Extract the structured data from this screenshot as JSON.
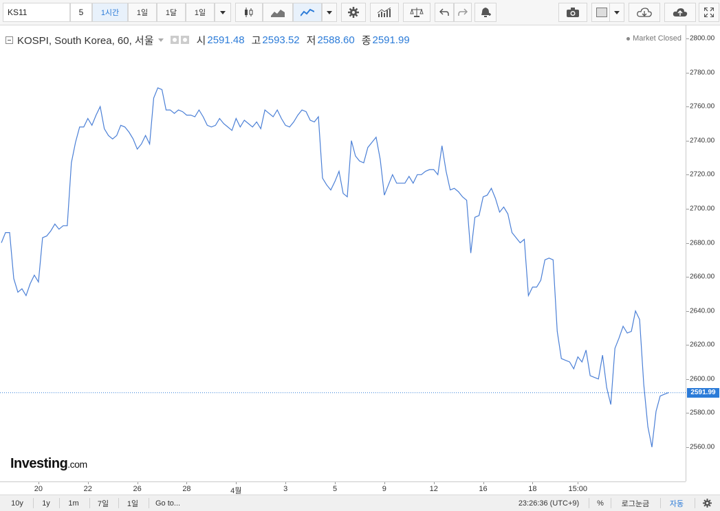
{
  "toolbar": {
    "symbol": "KS11",
    "interval_input": "5",
    "timeframes": [
      "1시간",
      "1일",
      "1달",
      "1일"
    ]
  },
  "legend": {
    "name": "KOSPI, South Korea, 60, 서울",
    "open_label": "시",
    "open": "2591.48",
    "high_label": "고",
    "high": "2593.52",
    "low_label": "저",
    "low": "2588.60",
    "close_label": "종",
    "close": "2591.99",
    "market_status": "Market Closed"
  },
  "branding": {
    "logo_main": "Investing",
    "logo_suffix": ".com"
  },
  "colors": {
    "line": "#4a7fd6",
    "accent": "#2b7bd8"
  },
  "bottom_bar": {
    "ranges": [
      "10y",
      "1y",
      "1m",
      "7일",
      "1일"
    ],
    "goto_label": "Go to...",
    "time": "23:26:36 (UTC+9)",
    "percent_label": "%",
    "log_label": "로그눈금",
    "auto_label": "자동"
  },
  "chart_data": {
    "type": "line",
    "title": "",
    "xlabel": "",
    "ylabel": "",
    "ylim": [
      2540,
      2805
    ],
    "yticks": [
      2800,
      2780,
      2760,
      2740,
      2720,
      2700,
      2680,
      2660,
      2640,
      2620,
      2600,
      2580,
      2560
    ],
    "ytick_labels": [
      "2800.00",
      "2780.00",
      "2760.00",
      "2740.00",
      "2720.00",
      "2700.00",
      "2680.00",
      "2660.00",
      "2640.00",
      "2620.00",
      "2600.00",
      "2580.00",
      "2560.00"
    ],
    "xticks": [
      {
        "label": "20",
        "i": 9
      },
      {
        "label": "22",
        "i": 21
      },
      {
        "label": "26",
        "i": 33
      },
      {
        "label": "28",
        "i": 45
      },
      {
        "label": "4월",
        "i": 57
      },
      {
        "label": "3",
        "i": 69
      },
      {
        "label": "5",
        "i": 81
      },
      {
        "label": "9",
        "i": 93
      },
      {
        "label": "12",
        "i": 105
      },
      {
        "label": "16",
        "i": 117
      },
      {
        "label": "18",
        "i": 129
      },
      {
        "label": "15:00",
        "i": 140
      }
    ],
    "last_price": 2591.99,
    "last_price_label": "2591.99",
    "values": [
      2680,
      2686,
      2686,
      2659,
      2651,
      2653,
      2649,
      2656,
      2661,
      2657,
      2683,
      2684,
      2687,
      2691,
      2688,
      2690,
      2690,
      2727,
      2739,
      2748,
      2748,
      2753,
      2749,
      2755,
      2760,
      2747,
      2743,
      2741,
      2743,
      2749,
      2748,
      2745,
      2741,
      2735,
      2738,
      2743,
      2738,
      2765,
      2771,
      2770,
      2758,
      2758,
      2756,
      2758,
      2757,
      2755,
      2755,
      2754,
      2758,
      2754,
      2749,
      2748,
      2749,
      2753,
      2750,
      2748,
      2746,
      2753,
      2748,
      2752,
      2750,
      2748,
      2751,
      2747,
      2758,
      2756,
      2754,
      2758,
      2753,
      2749,
      2748,
      2751,
      2755,
      2758,
      2757,
      2752,
      2751,
      2754,
      2718,
      2714,
      2711,
      2716,
      2722,
      2709,
      2707,
      2740,
      2731,
      2728,
      2727,
      2736,
      2739,
      2742,
      2729,
      2708,
      2714,
      2720,
      2715,
      2715,
      2715,
      2719,
      2715,
      2720,
      2720,
      2722,
      2723,
      2723,
      2720,
      2737,
      2722,
      2711,
      2712,
      2710,
      2707,
      2705,
      2674,
      2695,
      2696,
      2707,
      2708,
      2712,
      2706,
      2698,
      2701,
      2697,
      2686,
      2683,
      2680,
      2682,
      2649,
      2654,
      2654,
      2658,
      2670,
      2671,
      2670,
      2628,
      2612,
      2611,
      2610,
      2606,
      2613,
      2610,
      2617,
      2602,
      2601,
      2600,
      2614,
      2595,
      2585,
      2618,
      2624,
      2631,
      2627,
      2628,
      2640,
      2635,
      2597,
      2572,
      2560,
      2581,
      2590,
      2591,
      2592
    ]
  }
}
